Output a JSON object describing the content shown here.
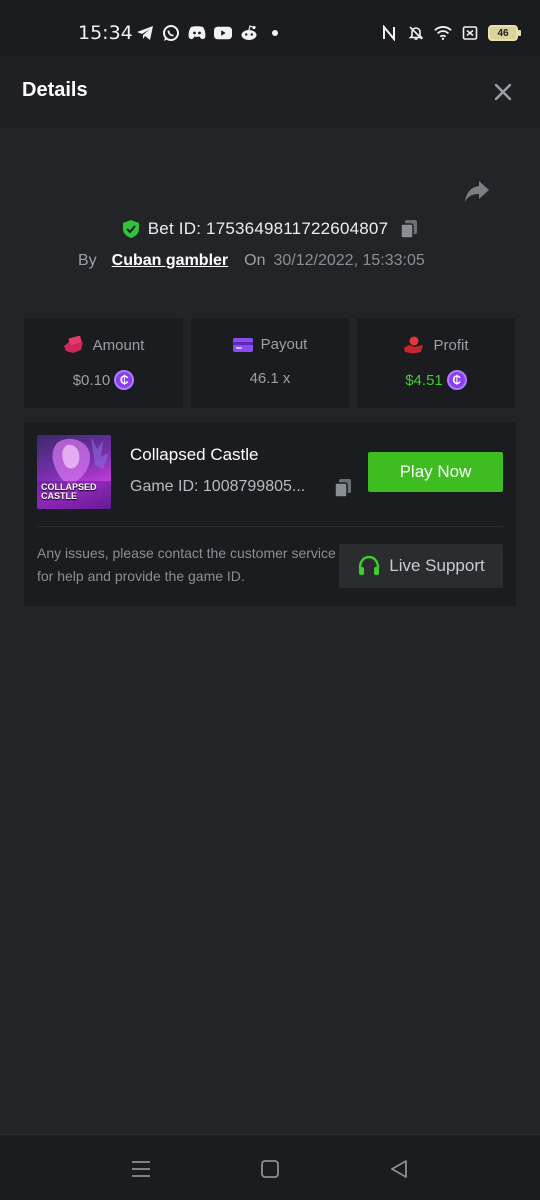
{
  "status_bar": {
    "time": "15:34",
    "left_icons": [
      "telegram-icon",
      "whatsapp-icon",
      "discord-icon",
      "youtube-icon",
      "reddit-icon",
      "dot-icon"
    ],
    "right_icons": [
      "nfc-icon",
      "mute-icon",
      "wifi-icon",
      "sim-off-icon"
    ],
    "battery": "46"
  },
  "header": {
    "title": "Details"
  },
  "bet": {
    "id_text": "Bet ID: 1753649811722604807",
    "by_label": "By",
    "username": "Cuban gambler",
    "on_label": "On",
    "date": "30/12/2022, 15:33:05"
  },
  "stats": {
    "amount": {
      "label": "Amount",
      "value": "$0.10"
    },
    "payout": {
      "label": "Payout",
      "value": "46.1 x"
    },
    "profit": {
      "label": "Profit",
      "value": "$4.51"
    }
  },
  "coin_symbol": "₵",
  "game": {
    "thumb_text_1": "COLLAPSED",
    "thumb_text_2": "CASTLE",
    "title": "Collapsed Castle",
    "id_text": "Game ID: 1008799805...",
    "play_label": "Play Now",
    "support_text": "Any issues, please contact the customer service for help and provide the game ID.",
    "support_label": "Live Support"
  },
  "colors": {
    "accent_green": "#3dbd1f",
    "profit_green": "#3fcf2b",
    "coin_purple": "#8a3ef0",
    "amount_pink": "#e83a6a",
    "payout_purple": "#8a4cf0",
    "profit_red": "#e8343a"
  }
}
